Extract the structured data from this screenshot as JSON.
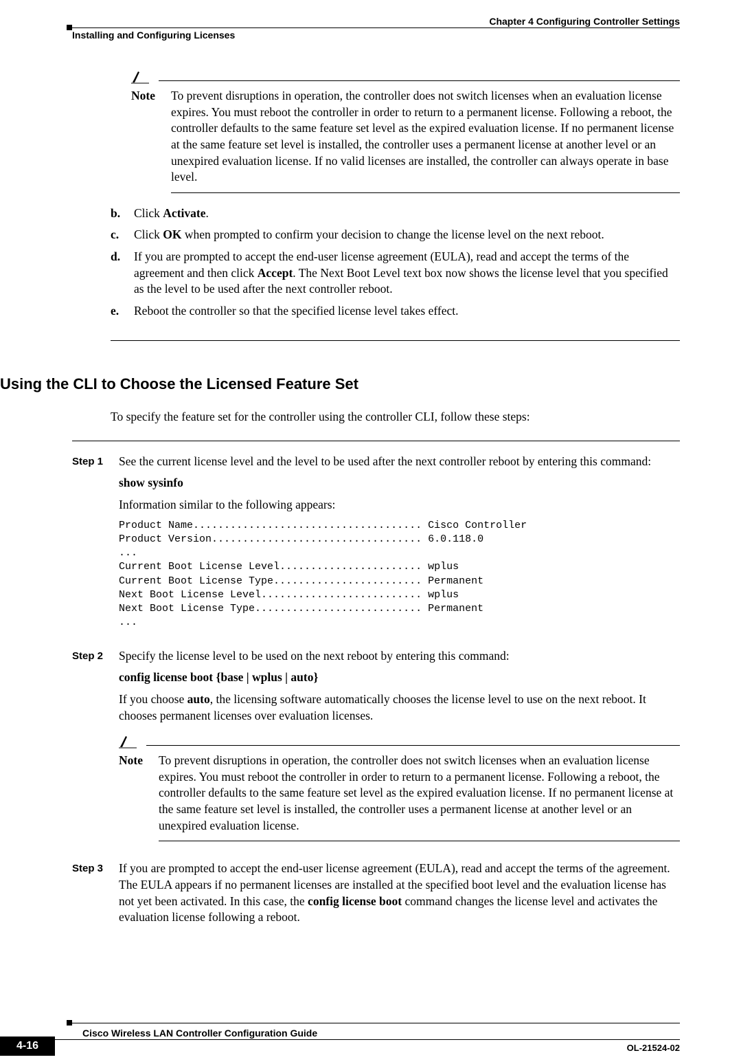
{
  "header": {
    "chapter": "Chapter 4      Configuring Controller Settings",
    "section": "Installing and Configuring Licenses"
  },
  "note1": {
    "label": "Note",
    "text": "To prevent disruptions in operation, the controller does not switch licenses when an evaluation license expires. You must reboot the controller in order to return to a permanent license. Following a reboot, the controller defaults to the same feature set level as the expired evaluation license. If no permanent license at the same feature set level is installed, the controller uses a permanent license at another level or an unexpired evaluation license. If no valid licenses are installed, the controller can always operate in base level."
  },
  "letters": {
    "b": {
      "lbl": "b.",
      "pre": "Click ",
      "bold": "Activate",
      "post": "."
    },
    "c": {
      "lbl": "c.",
      "pre": "Click ",
      "bold": "OK",
      "post": " when prompted to confirm your decision to change the license level on the next reboot."
    },
    "d": {
      "lbl": "d.",
      "pre": "If you are prompted to accept the end-user license agreement (EULA), read and accept the terms of the agreement and then click ",
      "bold": "Accept",
      "post": ". The Next Boot Level text box now shows the license level that you specified as the level to be used after the next controller reboot."
    },
    "e": {
      "lbl": "e.",
      "text": "Reboot the controller so that the specified license level takes effect."
    }
  },
  "h2": "Using the CLI to Choose the Licensed Feature Set",
  "intro": "To specify the feature set for the controller using the controller CLI, follow these steps:",
  "steps": {
    "s1": {
      "lbl": "Step 1",
      "p1": "See the current license level and the level to be used after the next controller reboot by entering this command:",
      "cmd": "show sysinfo",
      "p2": "Information similar to the following appears:",
      "cli": "Product Name..................................... Cisco Controller\nProduct Version.................................. 6.0.118.0\n...\nCurrent Boot License Level....................... wplus\nCurrent Boot License Type........................ Permanent\nNext Boot License Level.......................... wplus\nNext Boot License Type........................... Permanent\n..."
    },
    "s2": {
      "lbl": "Step 2",
      "p1": "Specify the license level to be used on the next reboot by entering this command:",
      "cmd_pre": "config license boot",
      "cmd_post": " {base | wplus | auto}",
      "p2a": "If you choose ",
      "p2b": "auto",
      "p2c": ", the licensing software automatically chooses the license level to use on the next reboot. It chooses permanent licenses over evaluation licenses.",
      "note": {
        "label": "Note",
        "text": "To prevent disruptions in operation, the controller does not switch licenses when an evaluation license expires. You must reboot the controller in order to return to a permanent license. Following a reboot, the controller defaults to the same feature set level as the expired evaluation license. If no permanent license at the same feature set level is installed, the controller uses a permanent license at another level or an unexpired evaluation license."
      }
    },
    "s3": {
      "lbl": "Step 3",
      "p_a": "If you are prompted to accept the end-user license agreement (EULA), read and accept the terms of the agreement. The EULA appears if no permanent licenses are installed at the specified boot level and the evaluation license has not yet been activated. In this case, the ",
      "p_b": "config license boot",
      "p_c": " command changes the license level and activates the evaluation license following a reboot."
    }
  },
  "footer": {
    "title": "Cisco Wireless LAN Controller Configuration Guide",
    "docnum": "OL-21524-02",
    "pagenum": "4-16"
  }
}
